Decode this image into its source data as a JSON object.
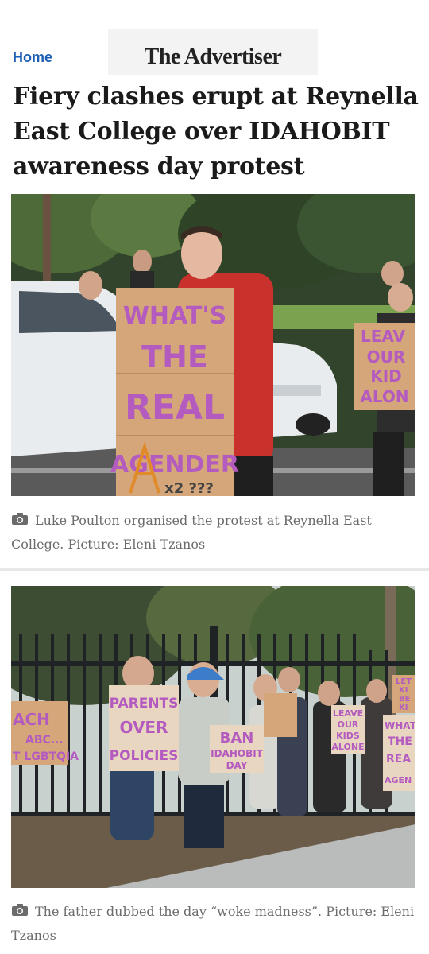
{
  "header": {
    "home_label": "Home",
    "logo_text": "The Advertiser"
  },
  "article": {
    "headline": "Fiery clashes erupt at Reynella East College over IDAHOBIT awareness day protest"
  },
  "photos": [
    {
      "caption": "Luke Poulton organised the protest at Reynella East College. Picture: Eleni Tzanos",
      "signs": {
        "main_line1": "WHAT'S",
        "main_line2": "THE",
        "main_line3": "REAL",
        "main_line4": "AGENDER",
        "main_line5": "x2 ???",
        "right_line1": "LEAV",
        "right_line2": "OUR",
        "right_line3": "KID",
        "right_line4": "ALON"
      }
    },
    {
      "caption": "The father dubbed the day “woke madness”. Picture: Eleni Tzanos",
      "signs": {
        "left_line1": "ACH",
        "left_line2": "ABC...",
        "left_line3": "T LGBTQIA",
        "parents_line1": "PARENTS",
        "parents_line2": "OVER",
        "parents_line3": "POLICIES",
        "ban_line1": "BAN",
        "ban_line2": "IDAHOBIT",
        "ban_line3": "DAY",
        "leave_line1": "LEAVE",
        "leave_line2": "OUR",
        "leave_line3": "KIDS",
        "leave_line4": "ALONE",
        "edge1_line1": "LET",
        "edge1_line2": "KI",
        "edge1_line3": "BE",
        "edge1_line4": "KI",
        "edge2_line1": "WHAT",
        "edge2_line2": "THE",
        "edge2_line3": "REA",
        "edge2_line4": "AGEN"
      }
    }
  ],
  "icons": {
    "caption_icon": "camera-icon"
  },
  "colors": {
    "home_link": "#1d5fb4",
    "caption_text": "#6b6b6b",
    "sign_ink": "#b45bc0"
  }
}
